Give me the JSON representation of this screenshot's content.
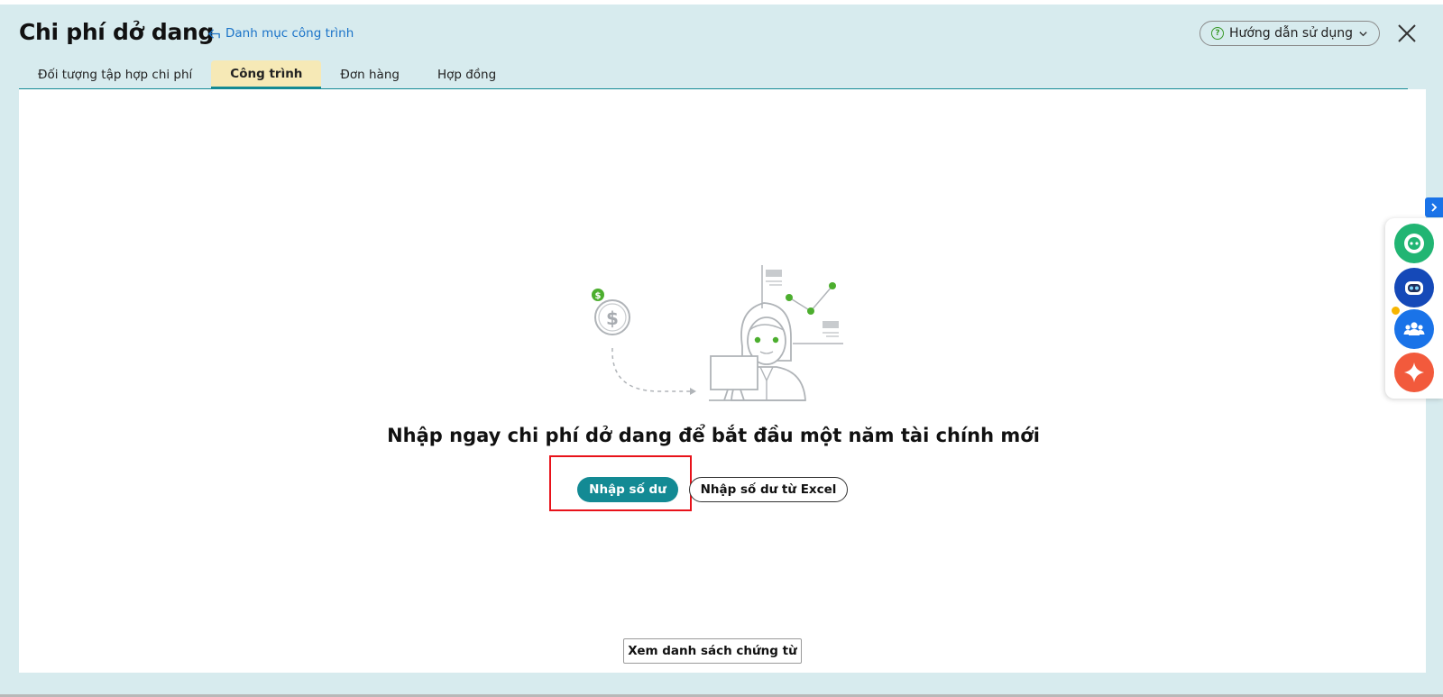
{
  "header": {
    "title": "Chi phí dở dang",
    "category_link": "Danh mục công trình",
    "help_label": "Hướng dẫn sử dụng"
  },
  "tabs": [
    {
      "label": "Đối tượng tập hợp chi phí",
      "active": false
    },
    {
      "label": "Công trình",
      "active": true
    },
    {
      "label": "Đơn hàng",
      "active": false
    },
    {
      "label": "Hợp đồng",
      "active": false
    }
  ],
  "empty_state": {
    "headline": "Nhập ngay chi phí dở dang để bắt đầu một năm tài chính mới",
    "primary_button": "Nhập số dư",
    "secondary_button": "Nhập số dư từ Excel"
  },
  "footer": {
    "vouchers_button": "Xem danh sách chứng từ"
  },
  "side_dock": {
    "items": [
      "chat-support-icon",
      "robot-assistant-icon",
      "community-icon",
      "ai-sparkle-icon"
    ]
  },
  "colors": {
    "accent": "#138a94",
    "background": "#d7ebee",
    "active_tab": "#f6e9b6",
    "highlight": "#e8121a",
    "link": "#1a73c8"
  }
}
